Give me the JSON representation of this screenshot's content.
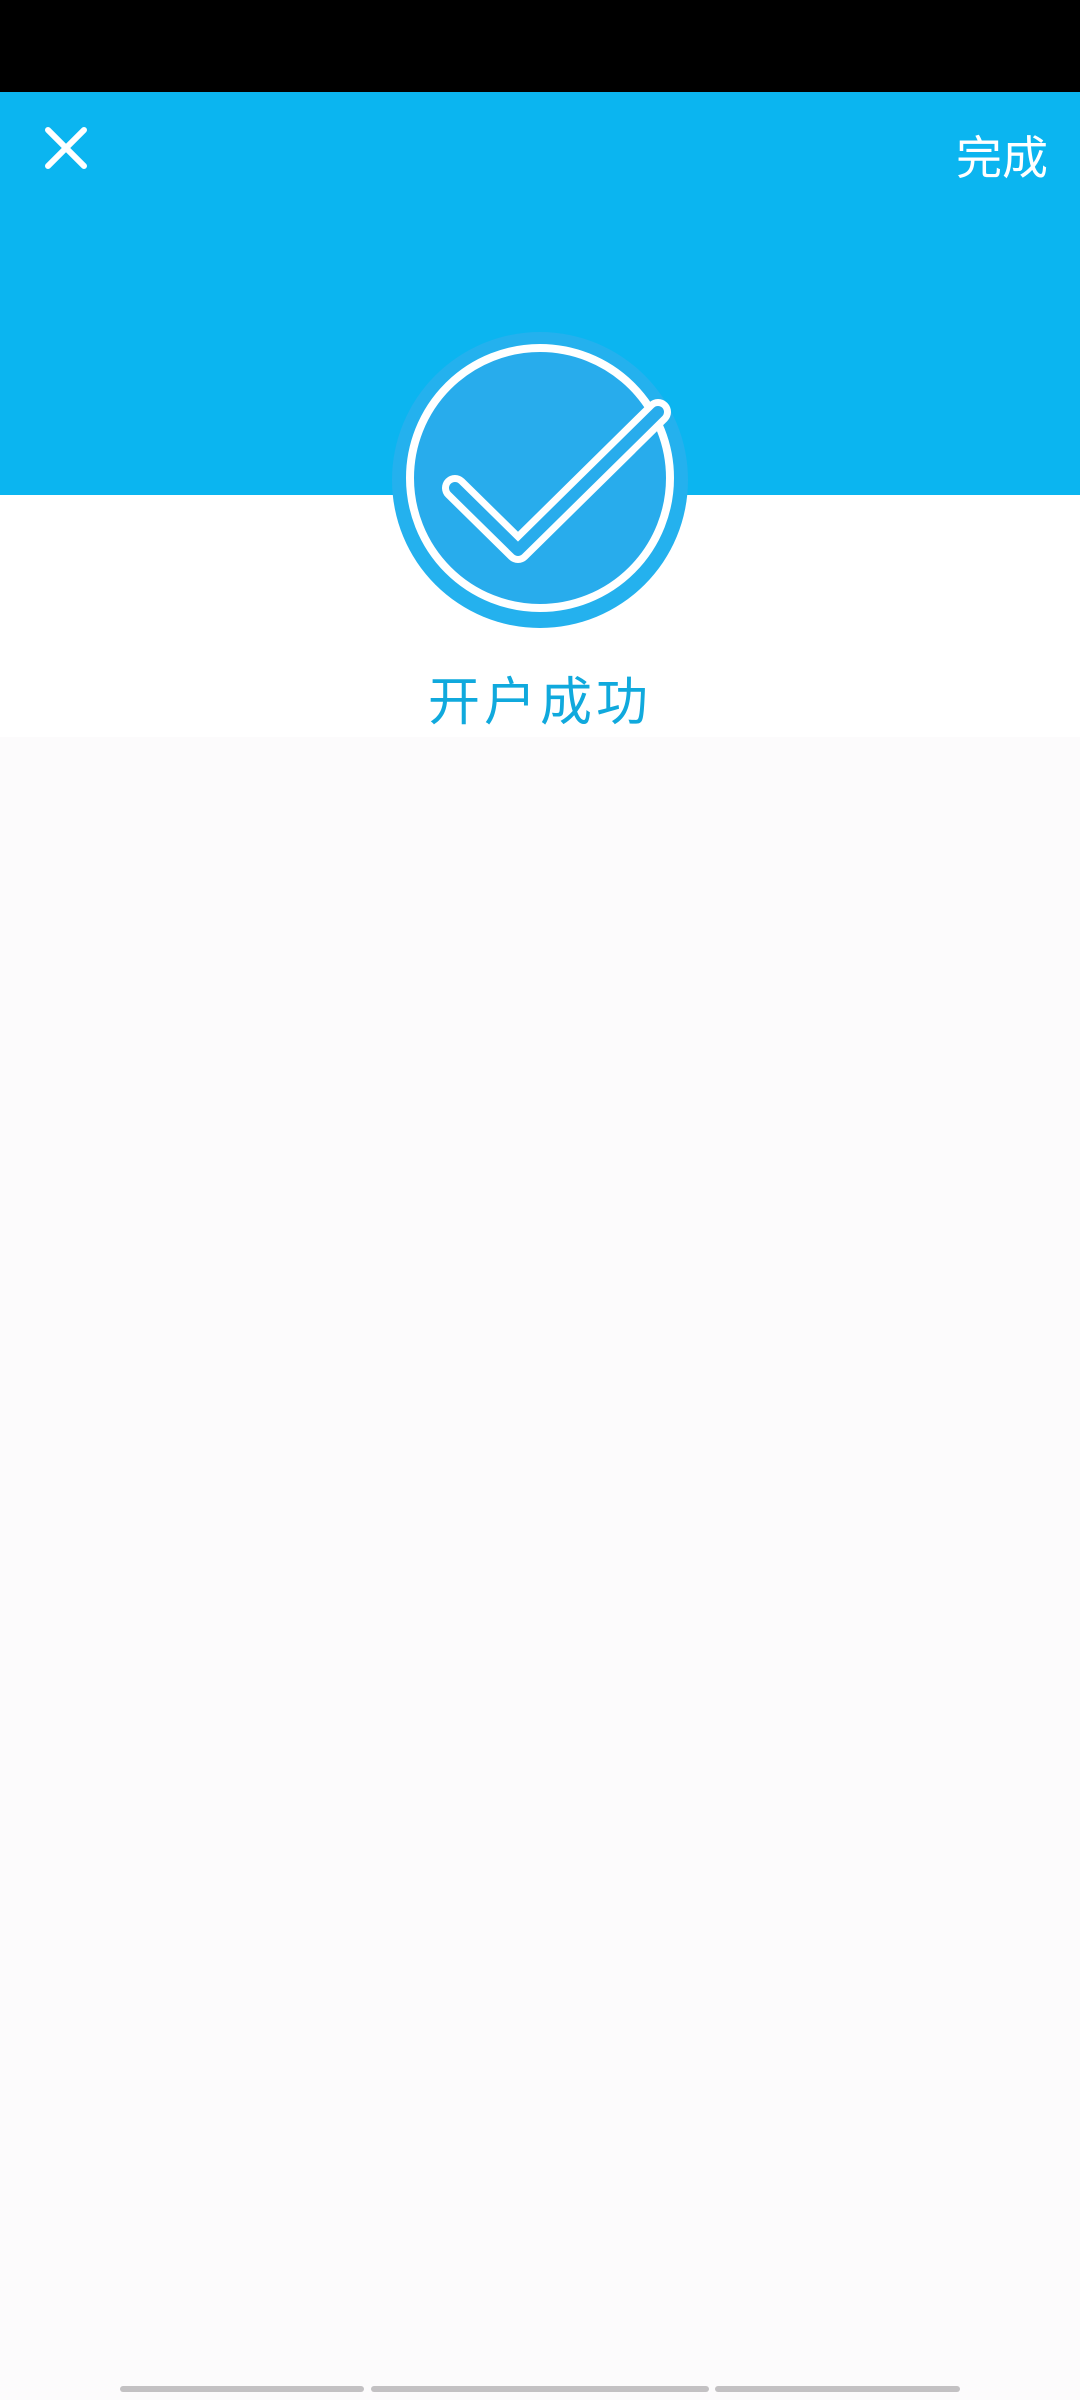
{
  "header": {
    "close_icon": "close-icon",
    "done_label": "完成",
    "background_color": "#0bb5f0"
  },
  "result": {
    "icon": "checkmark-circle-icon",
    "title": "开户成功",
    "accent_color": "#10a9dd"
  }
}
